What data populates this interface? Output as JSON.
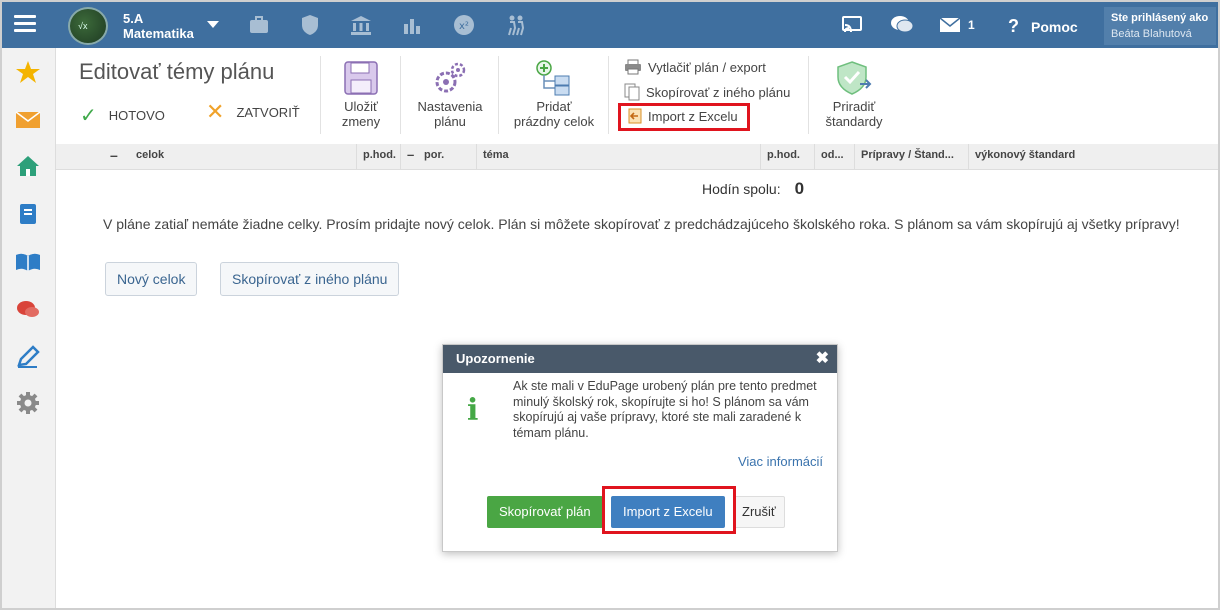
{
  "topbar": {
    "class_name": "5.A",
    "subject": "Matematika",
    "mail_count": "1",
    "help_label": "Pomoc",
    "logged_in_label": "Ste prihlásený ako",
    "user_name": "Beáta Blahutová"
  },
  "toolbar": {
    "title": "Editovať témy plánu",
    "done_label": "HOTOVO",
    "close_label": "ZATVORIŤ",
    "save_label_1": "Uložiť",
    "save_label_2": "zmeny",
    "settings_label_1": "Nastavenia",
    "settings_label_2": "plánu",
    "add_label_1": "Pridať",
    "add_label_2": "prázdny celok",
    "print_label": "Vytlačiť plán / export",
    "copy_label": "Skopírovať z iného plánu",
    "import_label": "Import z Excelu",
    "standards_label_1": "Priradiť",
    "standards_label_2": "štandardy"
  },
  "table": {
    "columns": [
      "celok",
      "p.hod.",
      "por.",
      "téma",
      "p.hod.",
      "od...",
      "Prípravy / Štand...",
      "výkonový štandard"
    ],
    "collapse_symbol": "–"
  },
  "main": {
    "hours_total_label": "Hodín spolu:",
    "hours_total_value": "0",
    "empty_message": "V pláne zatiaľ nemáte žiadne celky. Prosím pridajte nový celok. Plán si môžete skopírovať z predchádzajúceho školského roka. S plánom sa vám skopírujú aj všetky prípravy!",
    "new_unit_button": "Nový celok",
    "copy_button": "Skopírovať z iného plánu"
  },
  "modal": {
    "title": "Upozornenie",
    "close_symbol": "✖",
    "icon_letter": "i",
    "text": "Ak ste mali v EduPage urobený plán pre tento predmet minulý školský rok, skopírujte si ho! S plánom sa vám skopírujú aj vaše prípravy, ktoré ste mali zaradené k témam plánu.",
    "more_link": "Viac informácií",
    "copy_button": "Skopírovať plán",
    "import_button": "Import z Excelu",
    "cancel_button": "Zrušiť"
  },
  "colors": {
    "topbar": "#3f6f9f",
    "highlight": "#e0141e",
    "green": "#4aa644",
    "blue": "#3f7fc0"
  }
}
